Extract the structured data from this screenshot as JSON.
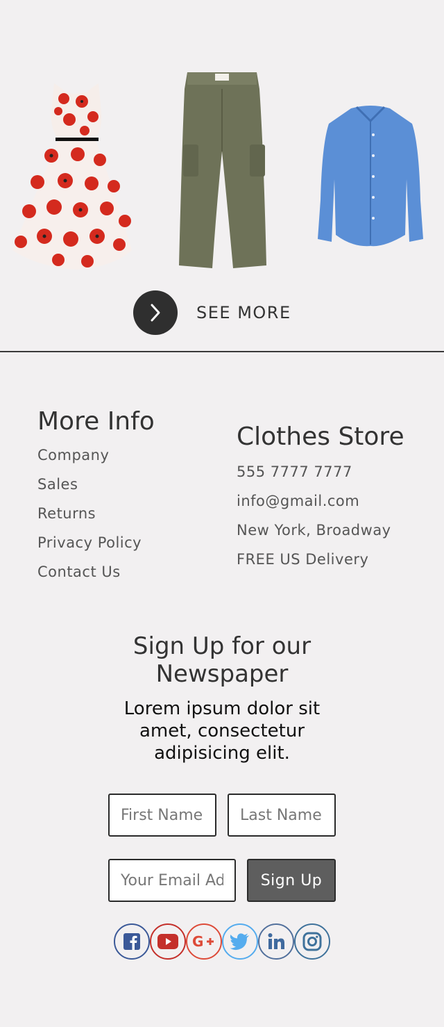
{
  "products": [
    {
      "name": "dress"
    },
    {
      "name": "pants"
    },
    {
      "name": "shirt"
    }
  ],
  "see_more": {
    "label": "SEE MORE"
  },
  "more_info": {
    "title": "More Info",
    "links": [
      "Company",
      "Sales",
      "Returns",
      "Privacy Policy",
      "Contact Us"
    ]
  },
  "store": {
    "title": "Clothes Store",
    "lines": [
      "555 7777 7777",
      "info@gmail.com",
      "New York, Broadway",
      "FREE US Delivery"
    ]
  },
  "newsletter": {
    "title": "Sign Up for our Newspaper",
    "text": "Lorem ipsum dolor sit amet, consectetur adipisicing elit.",
    "first_placeholder": "First Name",
    "last_placeholder": "Last Name",
    "email_placeholder": "Your Email Address",
    "button": "Sign Up"
  },
  "social": [
    {
      "icon": "facebook-icon",
      "color": "#3b5998"
    },
    {
      "icon": "youtube-icon",
      "color": "#c4302b"
    },
    {
      "icon": "google-plus-icon",
      "color": "#dd4b39"
    },
    {
      "icon": "twitter-icon",
      "color": "#55acee"
    },
    {
      "icon": "linkedin-icon",
      "color": "#0e76a8"
    },
    {
      "icon": "instagram-icon",
      "color": "#3f729b"
    }
  ]
}
